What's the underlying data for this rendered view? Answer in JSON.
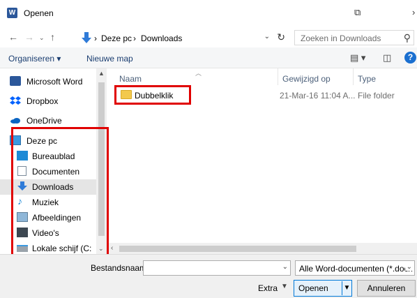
{
  "window": {
    "title": "Openen",
    "app_icon": "W"
  },
  "address": {
    "breadcrumb": [
      "Deze pc",
      "Downloads"
    ],
    "separator": "›",
    "search_placeholder": "Zoeken in Downloads"
  },
  "toolbar": {
    "organize": "Organiseren ▾",
    "new_folder": "Nieuwe map"
  },
  "sidebar": {
    "items": [
      {
        "label": "Microsoft Word",
        "icon": "word-icon"
      },
      {
        "label": "Dropbox",
        "icon": "dropbox-icon"
      },
      {
        "label": "OneDrive",
        "icon": "onedrive-icon"
      },
      {
        "label": "Deze pc",
        "icon": "computer-icon"
      },
      {
        "label": "Bureaublad",
        "icon": "desktop-icon"
      },
      {
        "label": "Documenten",
        "icon": "documents-icon"
      },
      {
        "label": "Downloads",
        "icon": "downloads-icon"
      },
      {
        "label": "Muziek",
        "icon": "music-icon"
      },
      {
        "label": "Afbeeldingen",
        "icon": "pictures-icon"
      },
      {
        "label": "Video's",
        "icon": "videos-icon"
      },
      {
        "label": "Lokale schijf (C:",
        "icon": "drive-icon"
      }
    ]
  },
  "list": {
    "columns": [
      "Naam",
      "Gewijzigd op",
      "Type"
    ],
    "rows": [
      {
        "name": "Dubbelklik",
        "modified": "21-Mar-16 11:04 A...",
        "type": "File folder"
      }
    ]
  },
  "bottom": {
    "filename_label": "Bestandsnaam:",
    "filename_value": "",
    "filter": "Alle Word-documenten (*.docx",
    "extra": "Extra",
    "open": "Openen",
    "cancel": "Annuleren"
  },
  "colors": {
    "highlight": "#e00000",
    "accent": "#0078d7",
    "folder": "#f3c94d"
  }
}
